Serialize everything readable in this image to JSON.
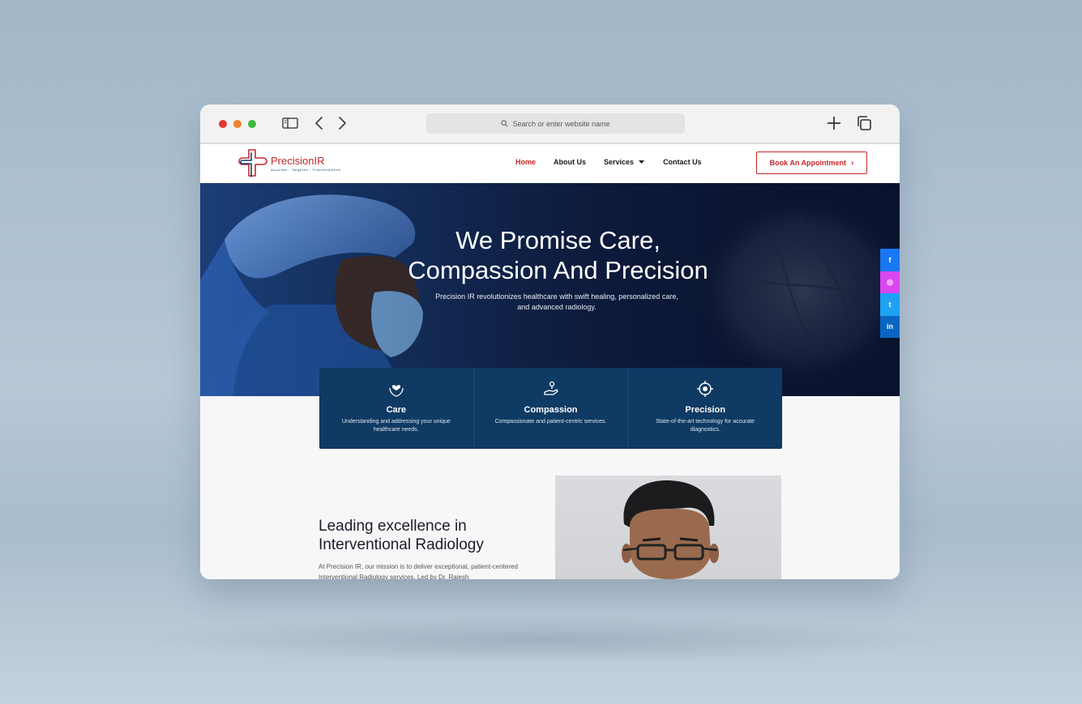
{
  "browser": {
    "address_placeholder": "Search or enter website name"
  },
  "site": {
    "logo": {
      "name": "PrecisionIR",
      "tagline": "Accurate · Targeted · Transformative"
    },
    "nav": {
      "items": [
        {
          "label": "Home",
          "active": true
        },
        {
          "label": "About Us",
          "active": false
        },
        {
          "label": "Services",
          "active": false
        },
        {
          "label": "Contact Us",
          "active": false
        }
      ],
      "cta": "Book An Appointment"
    },
    "hero": {
      "title_line1": "We Promise Care,",
      "title_line2": "Compassion And Precision",
      "subtitle": "Precision IR revolutionizes healthcare with swift healing, personalized care, and advanced radiology."
    },
    "social": [
      {
        "icon": "facebook-icon",
        "label": "f",
        "color": "#1877f2"
      },
      {
        "icon": "instagram-icon",
        "label": "◎",
        "color": "#d946ef"
      },
      {
        "icon": "twitter-icon",
        "label": "t",
        "color": "#1da1f2"
      },
      {
        "icon": "linkedin-icon",
        "label": "in",
        "color": "#0a66c2"
      }
    ],
    "features": [
      {
        "title": "Care",
        "desc": "Understanding and addressing your unique healthcare needs.",
        "icon": "heart-hands-icon"
      },
      {
        "title": "Compassion",
        "desc": "Compassionate and patient-centric services.",
        "icon": "helping-hand-icon"
      },
      {
        "title": "Precision",
        "desc": "State-of-the-art technology for accurate diagnostics.",
        "icon": "target-icon"
      }
    ],
    "about": {
      "title": "Leading excellence in Interventional Radiology",
      "text": "At Precision IR, our mission is to deliver exceptional, patient-centered Interventional Radiology services. Led by Dr. Rajesh"
    }
  },
  "colors": {
    "brand_red": "#c62828",
    "brand_navy": "#0f3a63"
  }
}
